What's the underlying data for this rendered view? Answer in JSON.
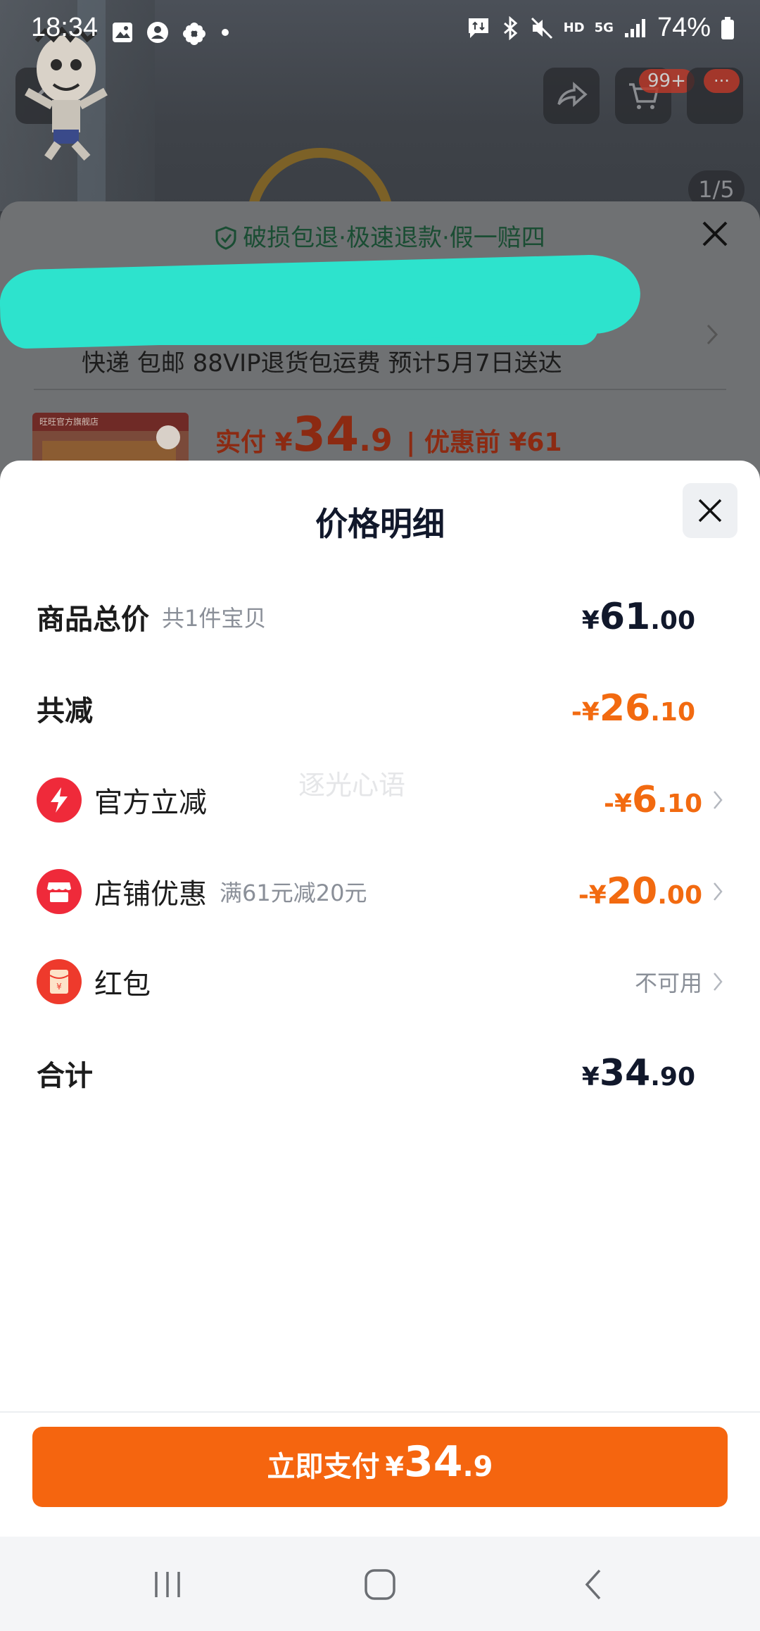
{
  "status_bar": {
    "time": "18:34",
    "battery": "74%",
    "network_hd": "HD",
    "network_5g": "5G"
  },
  "background_page": {
    "cart_badge": "99+",
    "menu_badge": "···",
    "image_counter": "1/5",
    "guarantee_text": "破损包退·极速退款·假一赔四",
    "shipping_text": "快递 包邮 88VIP退货包运费 预计5月7日送达",
    "product_thumb_tag": "旺旺官方旗舰店",
    "pay_label": "实付 ¥",
    "pay_int": "34",
    "pay_dec": ".9",
    "before_label": "| 优惠前 ¥61"
  },
  "price_detail": {
    "title": "价格明细",
    "rows": [
      {
        "label": "商品总价",
        "sub": "共1件宝贝",
        "yen": "¥",
        "int": "61",
        "dec": ".00"
      },
      {
        "label": "共减",
        "yen": "-¥",
        "int": "26",
        "dec": ".10"
      },
      {
        "label": "官方立减",
        "icon": "lightning-icon",
        "yen": "-¥",
        "int": "6",
        "dec": ".10"
      },
      {
        "label": "店铺优惠",
        "icon": "store-icon",
        "sub": "满61元减20元",
        "yen": "-¥",
        "int": "20",
        "dec": ".00"
      },
      {
        "label": "红包",
        "icon": "red-packet-icon",
        "value": "不可用"
      },
      {
        "label": "合计",
        "yen": "¥",
        "int": "34",
        "dec": ".90"
      }
    ],
    "watermark": "逐光心语"
  },
  "pay_button": {
    "label": "立即支付",
    "yen": "¥",
    "int": "34",
    "dec": ".9"
  },
  "colors": {
    "accent": "#f5650f",
    "discount": "#f26a10",
    "icon_red": "#ef2a3a",
    "title": "#11182b"
  }
}
